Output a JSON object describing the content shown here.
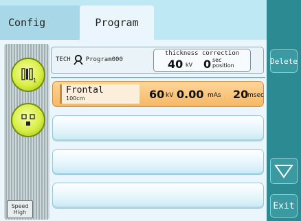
{
  "tabs": {
    "config": "Config",
    "program": "Program"
  },
  "right_panel": {
    "delete": "Delete",
    "exit": "Exit"
  },
  "left_panel": {
    "circle1_number": "1",
    "speed_line1": "Speed",
    "speed_line2": "High"
  },
  "tech": {
    "label": "TECH",
    "program": "Program000"
  },
  "thickness": {
    "title": "thickness correction",
    "kv": "40",
    "kv_unit": "kV",
    "sec": "0",
    "sec_unit_1": "sec",
    "sec_unit_2": "position"
  },
  "program_rows": [
    {
      "name": "Frontal",
      "distance": "100cm",
      "kv": "60",
      "kv_unit": "kV",
      "mas": "0.00",
      "mas_unit": "mAs",
      "msec": "20",
      "msec_unit": "msec"
    }
  ],
  "colors": {
    "accent": "#2c8a93",
    "selected_row": "#f6b865",
    "tab_bg": "#bde8f4"
  }
}
